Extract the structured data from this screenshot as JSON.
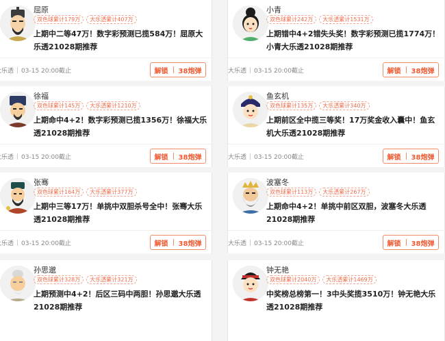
{
  "cards": [
    {
      "name": "屈原",
      "tag1": "双色球累计179万",
      "tag2": "大乐透累计407万",
      "desc": "上期中二等47万！数字彩预测已揽584万！屈原大乐透21028期推荐",
      "lottery": "大乐透",
      "time": "03-15 20:00截止",
      "unlock": "解锁",
      "price": "38炮弹",
      "avatar_icon": "qu-yuan-avatar-icon"
    },
    {
      "name": "小青",
      "tag1": "双色球累计242万",
      "tag2": "大乐透累计1531万",
      "desc": "上期错中4+2错失头奖！数字彩预测已揽1774万！小青大乐透21028期推荐",
      "lottery": "大乐透",
      "time": "03-15 20:00截止",
      "unlock": "解锁",
      "price": "38炮弹",
      "avatar_icon": "xiao-qing-avatar-icon"
    },
    {
      "name": "徐福",
      "tag1": "双色球累计145万",
      "tag2": "大乐透累计1210万",
      "desc": "上期命中4+2！数字彩预测已揽1356万！徐福大乐透21028期推荐",
      "lottery": "大乐透",
      "time": "03-15 20:00截止",
      "unlock": "解锁",
      "price": "38炮弹",
      "avatar_icon": "xu-fu-avatar-icon"
    },
    {
      "name": "鱼玄机",
      "tag1": "双色球累计135万",
      "tag2": "大乐透累计340万",
      "desc": "上期前区全中揽三等奖！17万奖金收入囊中！鱼玄机大乐透21028期推荐",
      "lottery": "大乐透",
      "time": "03-15 20:00截止",
      "unlock": "解锁",
      "price": "38炮弹",
      "avatar_icon": "yu-xuan-ji-avatar-icon"
    },
    {
      "name": "张骞",
      "tag1": "双色球累计164万",
      "tag2": "大乐透累计377万",
      "desc": "上期中三等17万！单挑中双胆杀号全中！张骞大乐透21028期推荐",
      "lottery": "大乐透",
      "time": "03-15 20:00截止",
      "unlock": "解锁",
      "price": "38炮弹",
      "avatar_icon": "zhang-qian-avatar-icon"
    },
    {
      "name": "波塞冬",
      "tag1": "双色球累计113万",
      "tag2": "大乐透累计267万",
      "desc": "上期命中4+2！单挑中前区双胆，波塞冬大乐透21028期推荐",
      "lottery": "大乐透",
      "time": "03-15 20:00截止",
      "unlock": "解锁",
      "price": "38炮弹",
      "avatar_icon": "poseidon-avatar-icon"
    },
    {
      "name": "孙思邈",
      "tag1": "双色球累计328万",
      "tag2": "大乐透累计321万",
      "desc": "上期预测中4+2！后区三码中两胆！孙思邈大乐透21028期推荐",
      "lottery": "",
      "time": "",
      "unlock": "",
      "price": "",
      "avatar_icon": "sun-si-miao-avatar-icon"
    },
    {
      "name": "钟无艳",
      "tag1": "双色球累计2040万",
      "tag2": "大乐透累计1469万",
      "desc": "中奖榜总榜第一！3中头奖揽3510万！钟无艳大乐透21028期推荐",
      "lottery": "",
      "time": "",
      "unlock": "",
      "price": "",
      "avatar_icon": "zhong-wu-yan-avatar-icon"
    }
  ],
  "colors": {
    "accent": "#ef5a31",
    "tag": "#ef6c49",
    "background": "#f4f4f4"
  }
}
